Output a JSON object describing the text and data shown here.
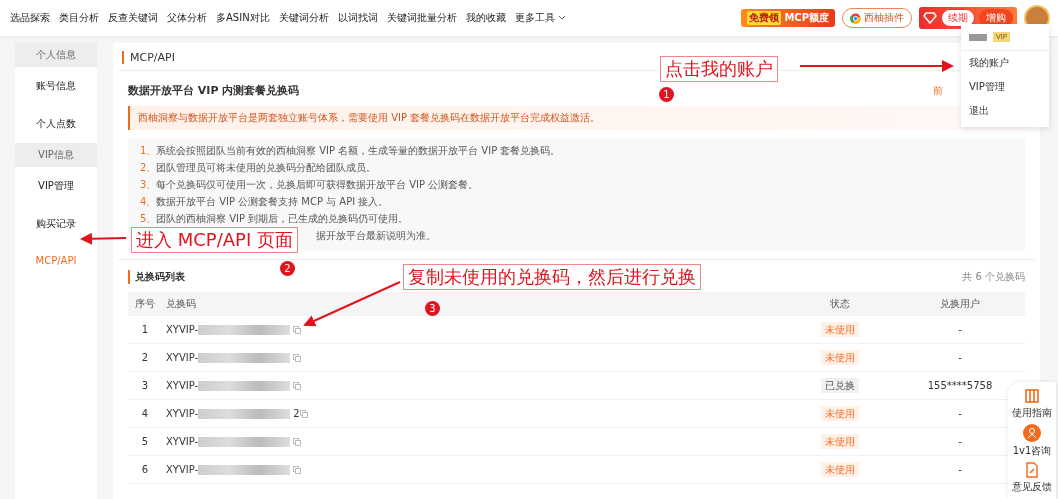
{
  "nav": {
    "items": [
      "选品探索",
      "类目分析",
      "反查关键词",
      "父体分析",
      "多ASIN对比",
      "关键词分析",
      "以词找词",
      "关键词批量分析",
      "我的收藏"
    ],
    "more": "更多工具"
  },
  "header_actions": {
    "promo_prefix": "免费领",
    "promo_label": "MCP额度",
    "plugin": "西柚插件",
    "renew": "续期",
    "upgrade": "增购"
  },
  "account_menu": {
    "badge": "VIP",
    "items": [
      {
        "label": "我的账户"
      },
      {
        "label": "VIP管理"
      },
      {
        "label": "退出"
      }
    ]
  },
  "sidebar": {
    "groups": [
      {
        "title": "个人信息",
        "items": [
          {
            "label": "账号信息",
            "selected": false
          },
          {
            "label": "个人点数",
            "selected": false
          }
        ]
      },
      {
        "title": "VIP信息",
        "items": [
          {
            "label": "VIP管理",
            "selected": false
          },
          {
            "label": "购买记录",
            "selected": false
          },
          {
            "label": "MCP/API",
            "selected": true
          }
        ]
      }
    ]
  },
  "page": {
    "title": "MCP/API",
    "card_title": "数据开放平台 VIP 内测套餐兑换码",
    "link": "前",
    "notice": "西柚洞察与数据开放平台是两套独立账号体系，需要使用 VIP 套餐兑换码在数据开放平台完成权益激活。",
    "steps": [
      {
        "number": "1、",
        "text": "系统会按照团队当前有效的西柚洞察 VIP 名额，生成等量的数据开放平台 VIP 套餐兑换码。"
      },
      {
        "number": "2、",
        "text": "团队管理员可将未使用的兑换码分配给团队成员。"
      },
      {
        "number": "3、",
        "text": "每个兑换码仅可使用一次，兑换后即可获得数据开放平台 VIP 公测套餐。"
      },
      {
        "number": "4、",
        "text": "数据开放平台 VIP 公测套餐支持 MCP 与 API 接入。"
      },
      {
        "number": "5、",
        "text": "团队的西柚洞察 VIP 到期后，已生成的兑换码仍可使用。"
      },
      {
        "text": "据开放平台最新说明为准。"
      }
    ]
  },
  "table": {
    "title": "兑换码列表",
    "count": "共 6 个兑换码",
    "columns": [
      "序号",
      "兑换码",
      "状态",
      "兑换用户"
    ],
    "rows": [
      {
        "index": "1",
        "code": "XYVIP-",
        "status": "未使用",
        "redeemed": false,
        "user": "-"
      },
      {
        "index": "2",
        "code": "XYVIP-",
        "status": "未使用",
        "redeemed": false,
        "user": "-"
      },
      {
        "index": "3",
        "code": "XYVIP-",
        "status": "已兑换",
        "redeemed": true,
        "user": "155****5758"
      },
      {
        "index": "4",
        "code": "XYVIP-",
        "code_tail": "2",
        "status": "未使用",
        "redeemed": false,
        "user": "-"
      },
      {
        "index": "5",
        "code": "XYVIP-",
        "status": "未使用",
        "redeemed": false,
        "user": "-"
      },
      {
        "index": "6",
        "code": "XYVIP-",
        "status": "未使用",
        "redeemed": false,
        "user": "-"
      }
    ]
  },
  "help_dock": [
    {
      "kind": "guide",
      "label": "使用指南"
    },
    {
      "kind": "chat",
      "label": "1v1咨询"
    },
    {
      "kind": "feedback",
      "label": "意见反馈"
    }
  ],
  "annotations": [
    {
      "number": "1",
      "text": "点击我的账户"
    },
    {
      "number": "2",
      "text": "进入 MCP/API 页面"
    },
    {
      "number": "3",
      "text": "复制未使用的兑换码，然后进行兑换"
    }
  ]
}
